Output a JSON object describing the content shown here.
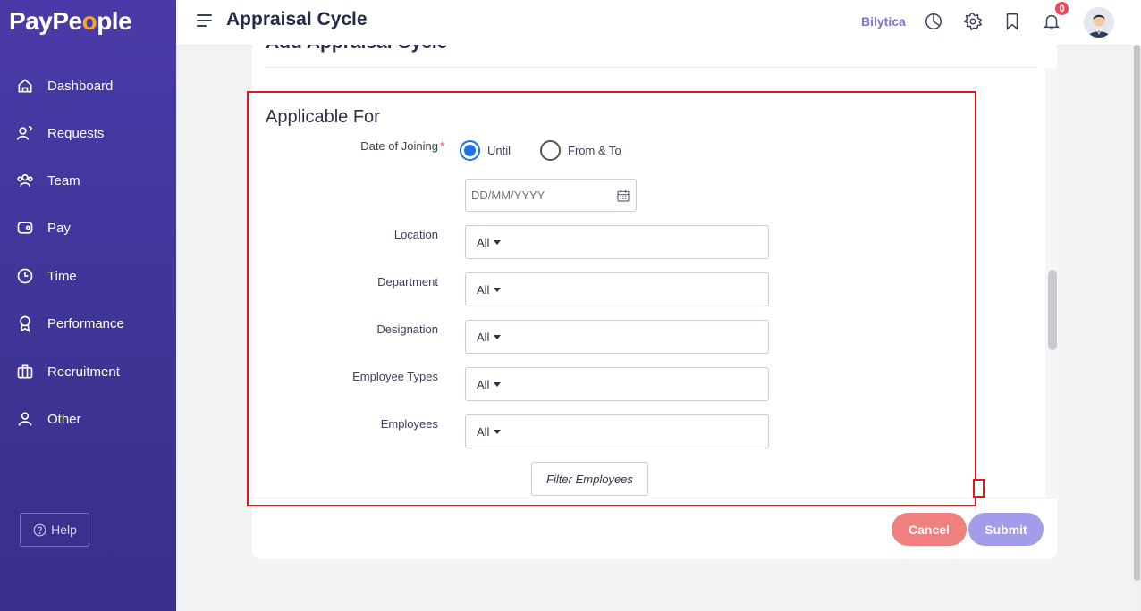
{
  "app": {
    "logo_pre": "PayPe",
    "logo_o": "o",
    "logo_post": "ple"
  },
  "sidebar": {
    "items": [
      {
        "label": "Dashboard",
        "icon": "home-icon"
      },
      {
        "label": "Requests",
        "icon": "requests-icon"
      },
      {
        "label": "Team",
        "icon": "team-icon"
      },
      {
        "label": "Pay",
        "icon": "wallet-icon"
      },
      {
        "label": "Time",
        "icon": "clock-icon"
      },
      {
        "label": "Performance",
        "icon": "award-icon"
      },
      {
        "label": "Recruitment",
        "icon": "briefcase-icon"
      },
      {
        "label": "Other",
        "icon": "user-icon"
      }
    ],
    "help_label": "Help"
  },
  "header": {
    "title": "Appraisal Cycle",
    "brand": "Bilytica",
    "notifications_count": "0"
  },
  "card": {
    "hidden_title": "Add Appraisal Cycle",
    "section_title": "Applicable For",
    "date_of_joining_label": "Date of Joining",
    "required_mark": "*",
    "radio_until": "Until",
    "radio_from_to": "From & To",
    "date_placeholder": "DD/MM/YYYY",
    "fields": [
      {
        "label": "Location",
        "value": "All"
      },
      {
        "label": "Department",
        "value": "All"
      },
      {
        "label": "Designation",
        "value": "All"
      },
      {
        "label": "Employee Types",
        "value": "All"
      },
      {
        "label": "Employees",
        "value": "All"
      }
    ],
    "filter_button": "Filter Employees",
    "cancel_button": "Cancel",
    "submit_button": "Submit"
  },
  "colors": {
    "sidebar": "#4a3aa8",
    "accent": "#7b76cf",
    "cancel": "#f08080",
    "submit": "#a39ce8",
    "radio_checked": "#1a73e8",
    "highlight": "#e8141b"
  }
}
